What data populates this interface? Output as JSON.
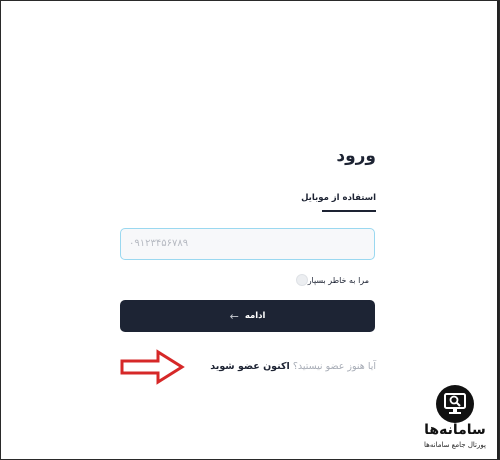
{
  "login": {
    "title": "ورود",
    "tab_label": "استفاده از موبایل",
    "phone_placeholder": "۰۹۱۲۳۴۵۶۷۸۹",
    "remember_label": "مرا به خاطر بسپار",
    "continue_label": "ادامه",
    "continue_icon": "arrow-left-icon",
    "signup_question": "آیا هنوز عضو نیستید؟",
    "signup_link": "اکنون عضو شوید"
  },
  "annotation": {
    "arrow_color": "#d62828",
    "arrow_icon": "red-arrow-icon"
  },
  "watermark": {
    "name": "سامانه‌ها",
    "subtitle": "پورتال جامع سامانه‌ها",
    "icon": "monitor-search-icon"
  },
  "colors": {
    "primary": "#1d2434",
    "input_border": "#9ad8f0",
    "muted_text": "#a6abb5"
  }
}
